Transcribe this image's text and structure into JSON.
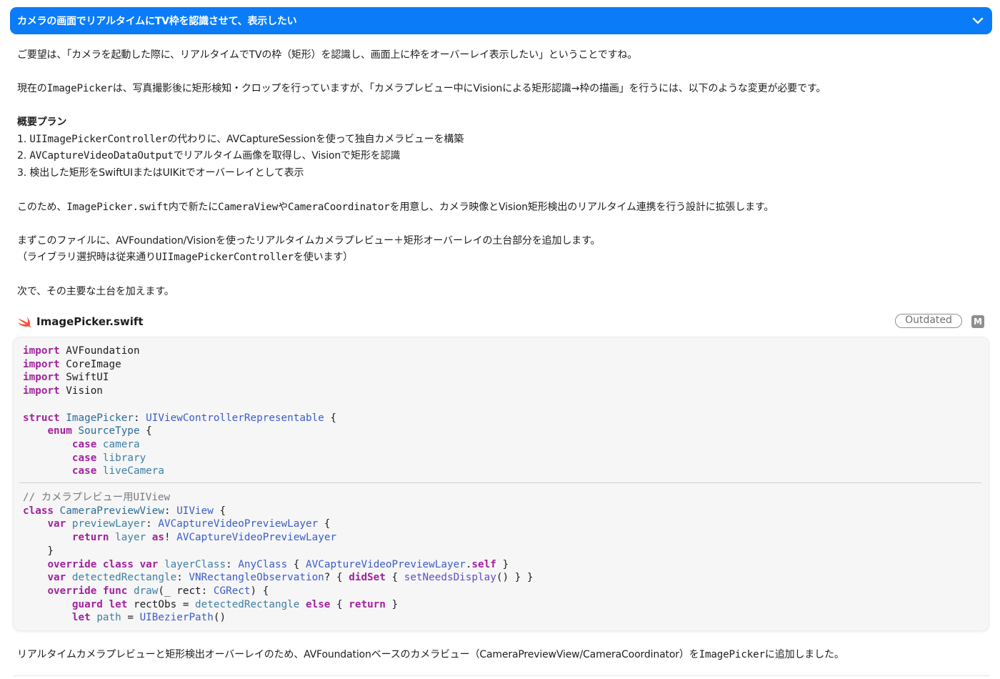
{
  "header": {
    "title": "カメラの画面でリアルタイムにTV枠を認識させて、表示したい"
  },
  "message": {
    "intro": "ご要望は、「カメラを起動した際に、リアルタイムでTVの枠（矩形）を認識し、画面上に枠をオーバーレイ表示したい」ということですね。",
    "current_pre": "現在の",
    "current_code": "ImagePicker",
    "current_post": "は、写真撮影後に矩形検知・クロップを行っていますが、「カメラプレビュー中にVisionによる矩形認識→枠の描画」を行うには、以下のような変更が必要です。",
    "plan_title": "概要プラン",
    "step1_pre": "1. ",
    "step1_code": "UIImagePickerController",
    "step1_post": "の代わりに、AVCaptureSessionを使って独自カメラビューを構築",
    "step2_pre": "2. ",
    "step2_code": "AVCaptureVideoDataOutput",
    "step2_post": "でリアルタイム画像を取得し、Visionで矩形を認識",
    "step3": "3. 検出した矩形をSwiftUIまたはUIKitでオーバーレイとして表示",
    "design_pre1": "このため、",
    "design_code1": "ImagePicker.swift",
    "design_mid1": "内で新たに",
    "design_code2": "CameraView",
    "design_mid2": "や",
    "design_code3": "CameraCoordinator",
    "design_post": "を用意し、カメラ映像とVision矩形検出のリアルタイム連携を行う設計に拡張します。",
    "first_line": "まずこのファイルに、AVFoundation/Visionを使ったリアルタイムカメラプレビュー＋矩形オーバーレイの土台部分を追加します。",
    "library_pre": "（ライブラリ選択時は従来通り",
    "library_code": "UIImagePickerController",
    "library_post": "を使います）",
    "next": "次で、その主要な土台を加えます。"
  },
  "file": {
    "name": "ImagePicker.swift",
    "status_badge": "Outdated",
    "git_badge": "M"
  },
  "code": {
    "text": "import AVFoundation\nimport CoreImage\nimport SwiftUI\nimport Vision\n\nstruct ImagePicker: UIViewControllerRepresentable {\n    enum SourceType {\n        case camera\n        case library\n        case liveCamera\n// カメラプレビュー用UIView\nclass CameraPreviewView: UIView {\n    var previewLayer: AVCaptureVideoPreviewLayer {\n        return layer as! AVCaptureVideoPreviewLayer\n    }\n    override class var layerClass: AnyClass { AVCaptureVideoPreviewLayer.self }\n    var detectedRectangle: VNRectangleObservation? { didSet { setNeedsDisplay() } }\n    override func draw(_ rect: CGRect) {\n        guard let rectObs = detectedRectangle else { return }\n        let path = UIBezierPath()"
  },
  "summary": {
    "pre": "リアルタイムカメラプレビューと矩形検出オーバーレイのため、AVFoundationベースのカメラビュー（CameraPreviewView/CameraCoordinator）を",
    "code": "ImagePicker",
    "post": "に追加しました。"
  },
  "colors": {
    "header_bg": "#0a7cf7",
    "keyword": "#a0239d",
    "type": "#3a5dc7",
    "swift_icon": "#f05138"
  },
  "icons": {
    "header_chevron": "chevron-down-icon",
    "file_type": "swift-icon"
  }
}
